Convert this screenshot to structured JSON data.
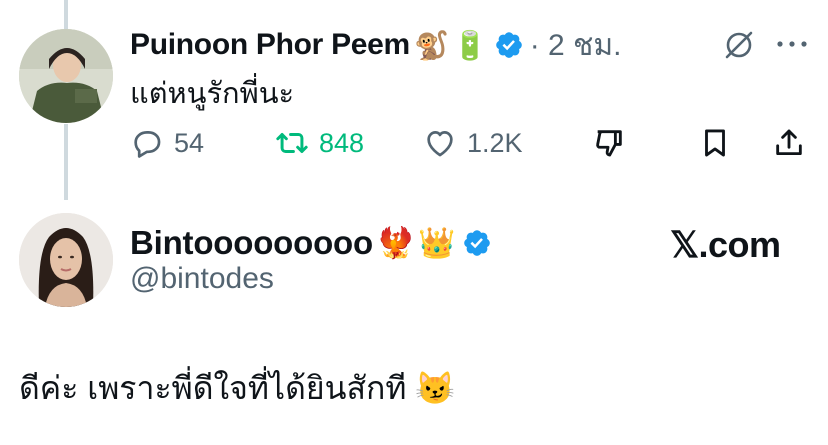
{
  "tweet": {
    "author_name": "Puinoon Phor Peem",
    "emojis": [
      "🐒",
      "🔋"
    ],
    "time": "· 2 ชม.",
    "text": "แต่หนูรักพี่นะ",
    "actions": {
      "replies": "54",
      "retweets": "848",
      "likes": "1.2K"
    },
    "retweet_color": "#00ba7c"
  },
  "reply": {
    "author_name": "Bintooooooooo",
    "emojis": [
      "🐦‍🔥",
      "👑"
    ],
    "handle": "@bintodes",
    "site": "𝕏.com",
    "text": "ดีค่ะ เพราะพี่ดีใจที่ได้ยินสักที 😼"
  },
  "colors": {
    "verified": "#1d9bf0",
    "muted": "#536471",
    "text": "#0f1419"
  }
}
